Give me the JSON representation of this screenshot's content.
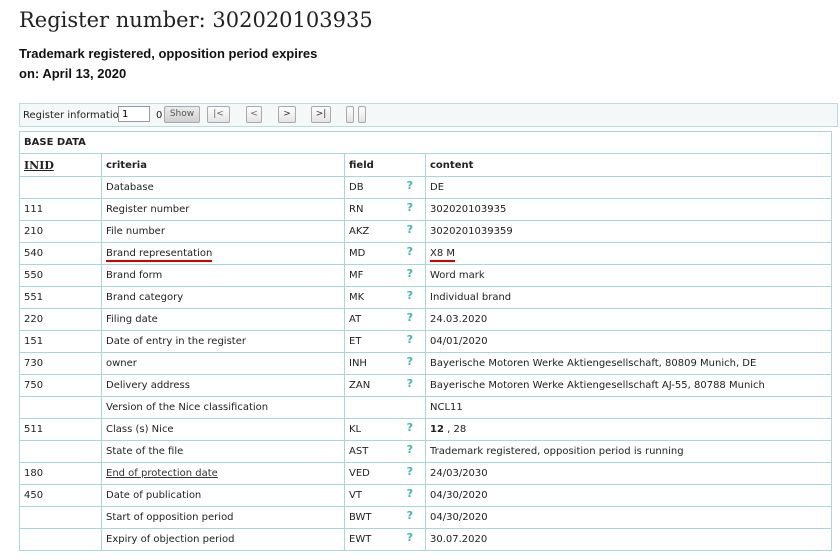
{
  "header": {
    "title": "Register number: 302020103935",
    "status_line1": "Trademark registered, opposition period expires",
    "status_line2": "on: April 13, 2020"
  },
  "nav": {
    "label": "Register information",
    "input_value": "1",
    "count": "0",
    "show_label": "Show",
    "first_label": "|<",
    "prev_label": "<",
    "next_label": ">",
    "last_label": ">|"
  },
  "table": {
    "section_title": "BASE DATA",
    "headers": {
      "inid": "INID",
      "criteria": "criteria",
      "field": "field",
      "content": "content"
    },
    "help_symbol": "?",
    "rows": [
      {
        "inid": "",
        "criteria": "Database",
        "field": "DB",
        "content": "DE"
      },
      {
        "inid": "111",
        "criteria": "Register number",
        "field": "RN",
        "content": "302020103935"
      },
      {
        "inid": "210",
        "criteria": "File number",
        "field": "AKZ",
        "content": "3020201039359"
      },
      {
        "inid": "540",
        "criteria": "Brand representation",
        "field": "MD",
        "content": "X8 M"
      },
      {
        "inid": "550",
        "criteria": "Brand form",
        "field": "MF",
        "content": "Word mark"
      },
      {
        "inid": "551",
        "criteria": "Brand category",
        "field": "MK",
        "content": "Individual brand"
      },
      {
        "inid": "220",
        "criteria": "Filing date",
        "field": "AT",
        "content": "24.03.2020"
      },
      {
        "inid": "151",
        "criteria": "Date of entry in the register",
        "field": "ET",
        "content": "04/01/2020"
      },
      {
        "inid": "730",
        "criteria": "owner",
        "field": "INH",
        "content": "Bayerische Motoren Werke Aktiengesellschaft, 80809 Munich, DE"
      },
      {
        "inid": "750",
        "criteria": "Delivery address",
        "field": "ZAN",
        "content": "Bayerische Motoren Werke Aktiengesellschaft AJ-55, 80788 Munich"
      },
      {
        "inid": "",
        "criteria": "Version of the Nice classification",
        "field": "",
        "content": "NCL11"
      },
      {
        "inid": "511",
        "criteria": "Class (s) Nice",
        "field": "KL",
        "content_bold": "12",
        "content_rest": " , 28"
      },
      {
        "inid": "",
        "criteria": "State of the file",
        "field": "AST",
        "content": "Trademark registered, opposition period is running"
      },
      {
        "inid": "180",
        "criteria": "End of protection date",
        "field": "VED",
        "content": "24/03/2030"
      },
      {
        "inid": "450",
        "criteria": "Date of publication",
        "field": "VT",
        "content": "04/30/2020"
      },
      {
        "inid": "",
        "criteria": "Start of opposition period",
        "field": "BWT",
        "content": "04/30/2020"
      },
      {
        "inid": "",
        "criteria": "Expiry of objection period",
        "field": "EWT",
        "content": "30.07.2020"
      }
    ]
  }
}
